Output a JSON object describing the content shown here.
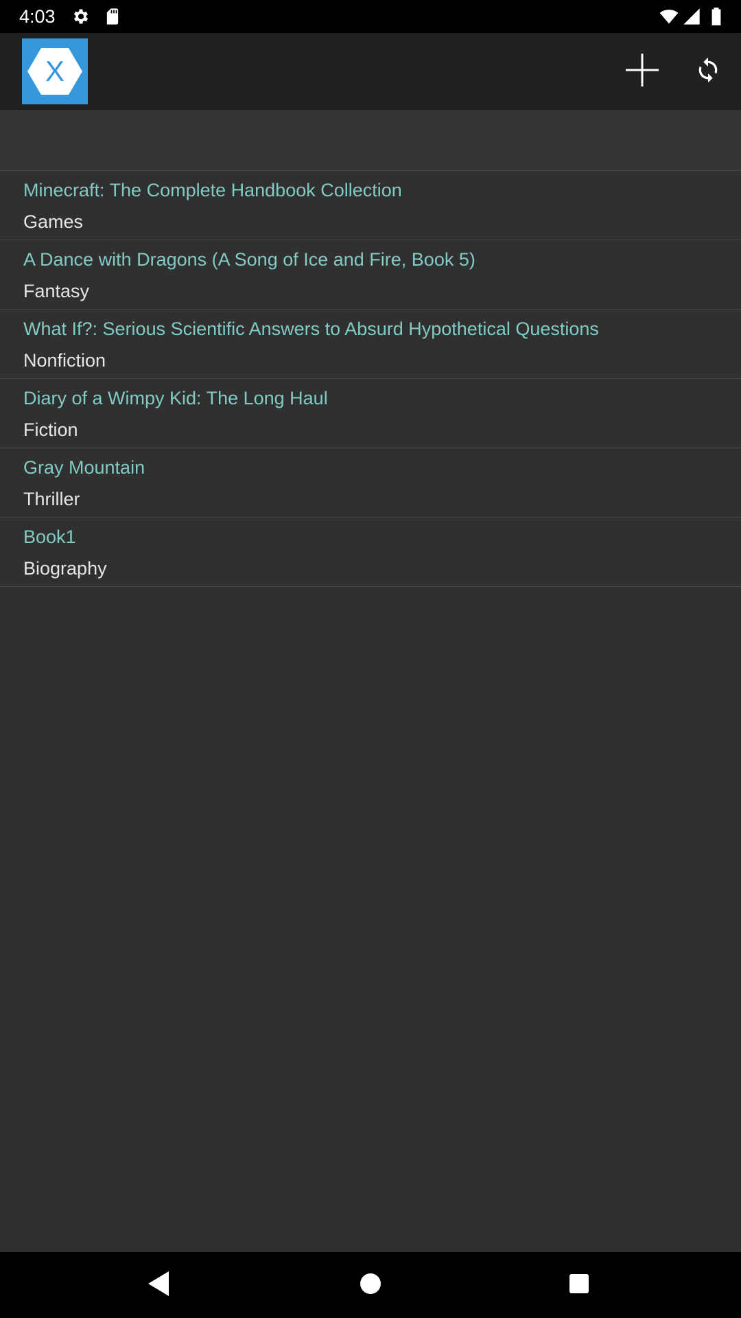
{
  "status_bar": {
    "time": "4:03",
    "icons": [
      "settings-icon",
      "sd-card-icon",
      "wifi-icon",
      "cellular-signal-icon",
      "battery-icon"
    ]
  },
  "app_bar": {
    "logo_icon": "xamarin-logo-icon",
    "logo_letter": "X",
    "actions": [
      "add-icon",
      "refresh-icon"
    ]
  },
  "colors": {
    "status_bar_bg": "#000000",
    "app_bar_bg": "#212121",
    "content_bg": "#303030",
    "logo_bg": "#3498db",
    "title_color": "#80cbc4",
    "genre_color": "#e6e6e6"
  },
  "books": [
    {
      "title": "Minecraft: The Complete Handbook Collection",
      "genre": "Games"
    },
    {
      "title": "A Dance with Dragons (A Song of Ice and Fire, Book 5)",
      "genre": "Fantasy"
    },
    {
      "title": "What If?: Serious Scientific Answers to Absurd Hypothetical Questions",
      "genre": "Nonfiction"
    },
    {
      "title": "Diary of a Wimpy Kid: The Long Haul",
      "genre": "Fiction"
    },
    {
      "title": "Gray Mountain",
      "genre": "Thriller"
    },
    {
      "title": "Book1",
      "genre": "Biography"
    }
  ],
  "nav_bar": {
    "buttons": [
      "back-icon",
      "home-icon",
      "recents-icon"
    ]
  }
}
